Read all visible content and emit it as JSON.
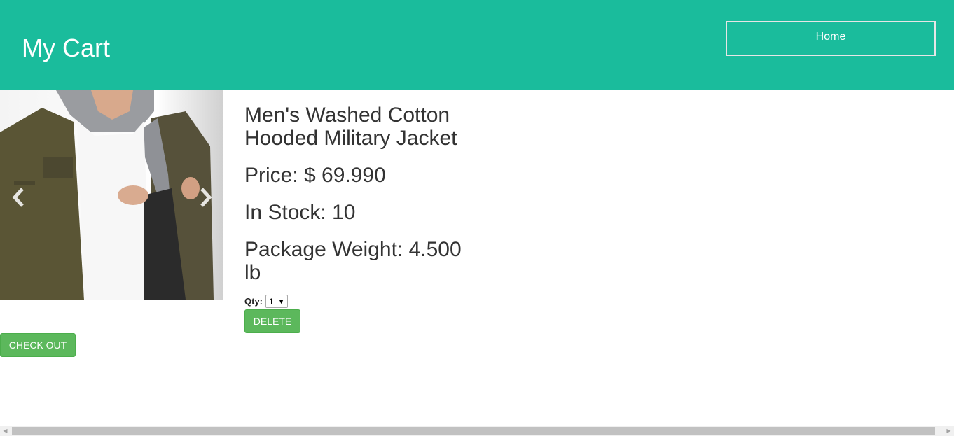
{
  "header": {
    "title": "My Cart",
    "home_label": "Home",
    "background_color": "#1abc9c"
  },
  "product": {
    "name": "Men's Washed Cotton Hooded Military Jacket",
    "price": "Price: $ 69.990",
    "stock": "In Stock: 10",
    "weight": "Package Weight: 4.500 lb",
    "qty_label": "Qty:",
    "qty_value": "1",
    "delete_label": "DELETE",
    "image_icon": "product-image",
    "carousel_prev_icon": "chevron-left-icon",
    "carousel_next_icon": "chevron-right-icon"
  },
  "cart": {
    "checkout_label": "CHECK OUT",
    "button_color": "#5cb85c"
  }
}
